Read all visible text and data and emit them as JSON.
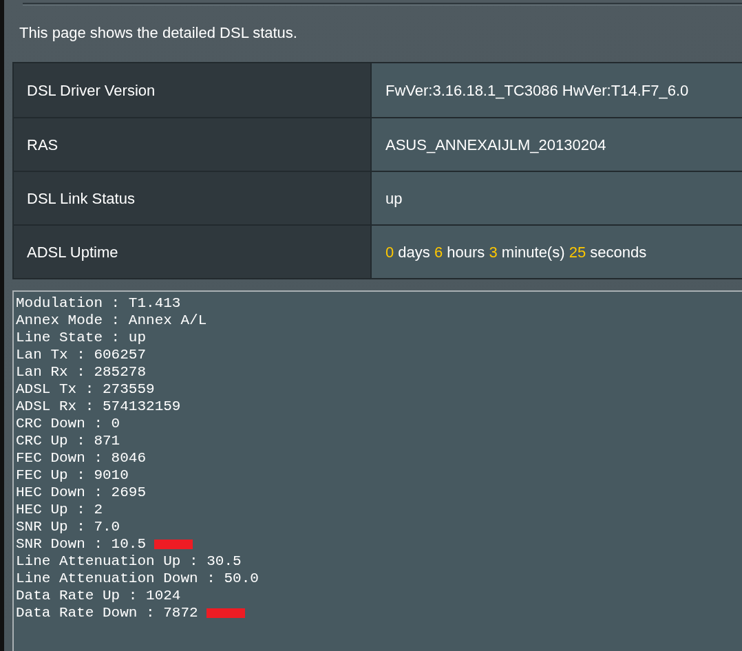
{
  "description": "This page shows the detailed DSL status.",
  "info_table": [
    {
      "label": "DSL Driver Version",
      "value": [
        {
          "text": "FwVer:3.16.18.1_TC3086 HwVer:T14.F7_6.0",
          "kind": "plain"
        }
      ]
    },
    {
      "label": "RAS",
      "value": [
        {
          "text": "ASUS_ANNEXAIJLM_20130204",
          "kind": "plain"
        }
      ]
    },
    {
      "label": "DSL Link Status",
      "value": [
        {
          "text": "up",
          "kind": "plain"
        }
      ]
    },
    {
      "label": "ADSL Uptime",
      "value": [
        {
          "text": "0",
          "kind": "number"
        },
        {
          "text": " days ",
          "kind": "plain"
        },
        {
          "text": "6",
          "kind": "number"
        },
        {
          "text": " hours ",
          "kind": "plain"
        },
        {
          "text": "3",
          "kind": "number"
        },
        {
          "text": " minute(s) ",
          "kind": "plain"
        },
        {
          "text": "25",
          "kind": "number"
        },
        {
          "text": " seconds",
          "kind": "plain"
        }
      ]
    }
  ],
  "log_lines": [
    {
      "text": "Modulation : T1.413",
      "marked": false
    },
    {
      "text": "Annex Mode : Annex A/L",
      "marked": false
    },
    {
      "text": "Line State : up",
      "marked": false
    },
    {
      "text": "Lan Tx : 606257",
      "marked": false
    },
    {
      "text": "Lan Rx : 285278",
      "marked": false
    },
    {
      "text": "ADSL Tx : 273559",
      "marked": false
    },
    {
      "text": "ADSL Rx : 574132159",
      "marked": false
    },
    {
      "text": "CRC Down : 0",
      "marked": false
    },
    {
      "text": "CRC Up : 871",
      "marked": false
    },
    {
      "text": "FEC Down : 8046",
      "marked": false
    },
    {
      "text": "FEC Up : 9010",
      "marked": false
    },
    {
      "text": "HEC Down : 2695",
      "marked": false
    },
    {
      "text": "HEC Up : 2",
      "marked": false
    },
    {
      "text": "SNR Up : 7.0",
      "marked": false
    },
    {
      "text": "SNR Down : 10.5",
      "marked": true
    },
    {
      "text": "Line Attenuation Up : 30.5",
      "marked": false
    },
    {
      "text": "Line Attenuation Down : 50.0",
      "marked": false
    },
    {
      "text": "Data Rate Up : 1024",
      "marked": false
    },
    {
      "text": "Data Rate Down : 7872",
      "marked": true
    }
  ]
}
